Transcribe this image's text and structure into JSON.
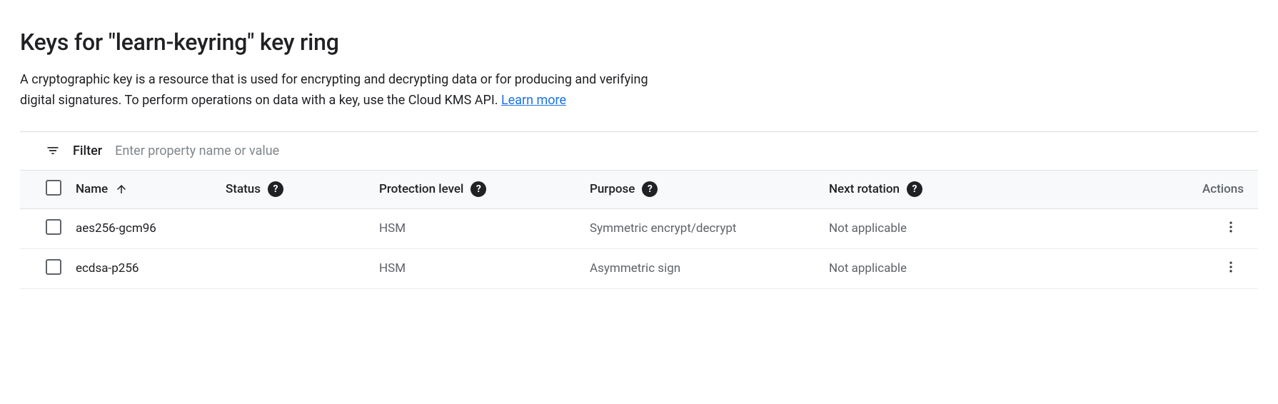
{
  "header": {
    "title": "Keys for \"learn-keyring\" key ring",
    "description": "A cryptographic key is a resource that is used for encrypting and decrypting data or for producing and verifying digital signatures. To perform operations on data with a key, use the Cloud KMS API. ",
    "learn_more": "Learn more"
  },
  "filter": {
    "label": "Filter",
    "placeholder": "Enter property name or value"
  },
  "table": {
    "columns": {
      "name": "Name",
      "status": "Status",
      "protection": "Protection level",
      "purpose": "Purpose",
      "rotation": "Next rotation",
      "actions": "Actions"
    },
    "rows": [
      {
        "name": "aes256-gcm96",
        "status": "",
        "protection": "HSM",
        "purpose": "Symmetric encrypt/decrypt",
        "rotation": "Not applicable"
      },
      {
        "name": "ecdsa-p256",
        "status": "",
        "protection": "HSM",
        "purpose": "Asymmetric sign",
        "rotation": "Not applicable"
      }
    ]
  }
}
